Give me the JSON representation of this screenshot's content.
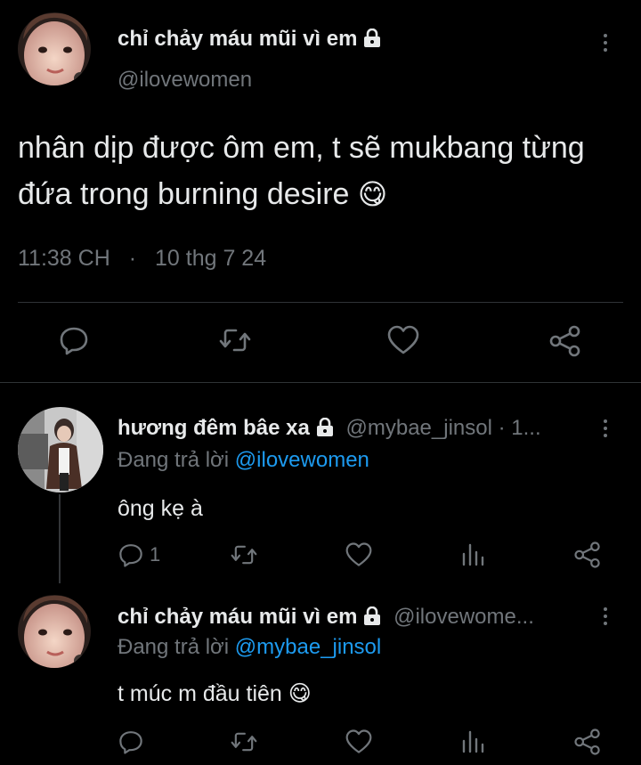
{
  "main_tweet": {
    "display_name": "chỉ chảy máu mũi vì em",
    "handle": "@ilovewomen",
    "text": "nhân dịp được ôm em, t sẽ mukbang từng đứa trong burning desire",
    "emoji": "😋",
    "time": "11:38 CH",
    "separator": "·",
    "date": "10 thg 7 24"
  },
  "replies": [
    {
      "display_name": "hương đêm bâe xa",
      "handle_meta": "@mybae_jinsol · 1...",
      "replying_prefix": "Đang trả lời",
      "replying_to": "@ilovewomen",
      "text": "ông kẹ à",
      "emoji": "",
      "reply_count": "1"
    },
    {
      "display_name": "chỉ chảy máu mũi vì em",
      "handle_meta": "@ilovewome...",
      "replying_prefix": "Đang trả lời",
      "replying_to": "@mybae_jinsol",
      "text": "t múc m đầu tiên",
      "emoji": "😋",
      "reply_count": ""
    }
  ],
  "icons": {
    "lock": "lock-icon",
    "more": "more-vertical-icon",
    "reply": "reply-icon",
    "retweet": "retweet-icon",
    "like": "heart-icon",
    "views": "views-icon",
    "share": "share-icon"
  },
  "colors": {
    "background": "#000000",
    "text": "#e7e9ea",
    "muted": "#71767b",
    "link": "#1d9bf0",
    "divider": "#2f3336"
  }
}
